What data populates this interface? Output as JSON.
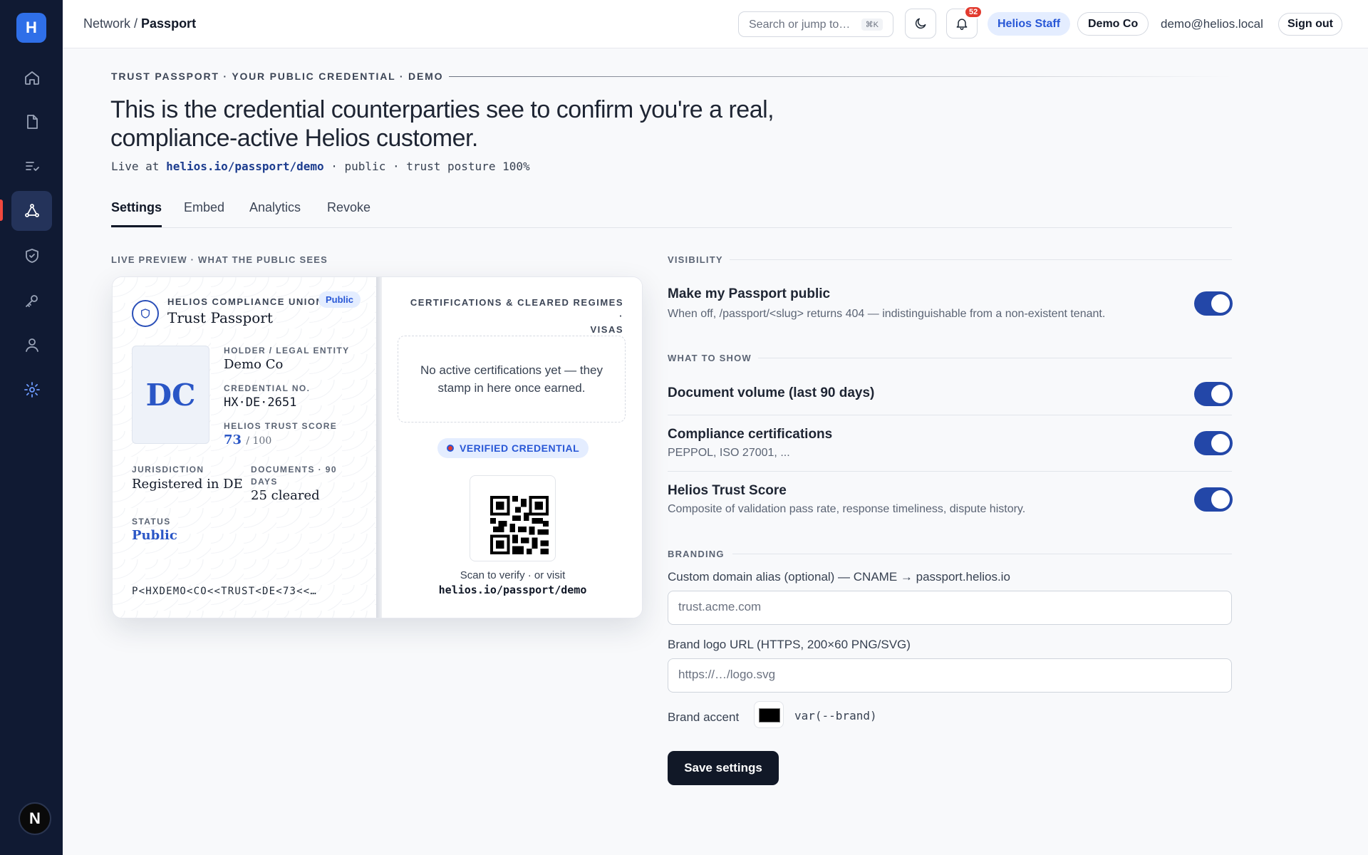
{
  "sidebar": {
    "logo": "H",
    "items": [
      {
        "icon": "home-icon"
      },
      {
        "icon": "document-icon"
      },
      {
        "icon": "checklist-icon"
      },
      {
        "icon": "network-icon"
      },
      {
        "icon": "shield-check-icon"
      },
      {
        "icon": "key-icon"
      },
      {
        "icon": "user-icon"
      },
      {
        "icon": "gear-icon"
      }
    ],
    "user_avatar": "N"
  },
  "topbar": {
    "breadcrumb_parent": "Network",
    "breadcrumb_sep": " / ",
    "breadcrumb_current": "Passport",
    "search_placeholder": "Search or jump to…",
    "search_shortcut": "⌘K",
    "notification_count": "52",
    "staff_badge": "Helios Staff",
    "org_name": "Demo Co",
    "email": "demo@helios.local",
    "signout": "Sign out"
  },
  "header": {
    "eyebrow": "TRUST PASSPORT · YOUR PUBLIC CREDENTIAL · DEMO",
    "headline": "This is the credential counterparties see to confirm you're a real, compliance-active Helios customer.",
    "live_prefix": "Live at ",
    "live_url": "helios.io/passport/demo",
    "live_suffix": " · public · trust posture 100%"
  },
  "tabs": [
    "Settings",
    "Embed",
    "Analytics",
    "Revoke"
  ],
  "preview": {
    "label": "LIVE PREVIEW · WHAT THE PUBLIC SEES",
    "issuer": "HELIOS COMPLIANCE UNION",
    "public_chip": "Public",
    "title": "Trust Passport",
    "initials": "DC",
    "holder_label": "HOLDER / LEGAL ENTITY",
    "holder_value": "Demo Co",
    "credential_label": "CREDENTIAL NO.",
    "credential_value": "HX·DE·2651",
    "score_label": "HELIOS TRUST SCORE",
    "score_value": "73",
    "score_max": "/ 100",
    "jurisdiction_label": "JURISDICTION",
    "jurisdiction_value": "Registered in DE",
    "documents_label_1": "DOCUMENTS · 90",
    "documents_label_2": "DAYS",
    "documents_value": "25 cleared",
    "status_label": "STATUS",
    "status_value": "Public",
    "mrz": "P<HXDEMO<CO<<TRUST<DE<73<<…",
    "certs_title_1": "CERTIFICATIONS & CLEARED REGIMES ·",
    "certs_title_2": "VISAS",
    "certs_empty": "No active certifications yet — they stamp in here once earned.",
    "verified": "VERIFIED CREDENTIAL",
    "scan_text": "Scan to verify · or visit",
    "scan_url": "helios.io/passport/demo"
  },
  "settings": {
    "visibility_label": "VISIBILITY",
    "public_title": "Make my Passport public",
    "public_desc": "When off, /passport/<slug> returns 404 — indistinguishable from a non-existent tenant.",
    "public_on": true,
    "show_label": "WHAT TO SHOW",
    "doc_volume_title": "Document volume (last 90 days)",
    "doc_volume_on": true,
    "certs_title": "Compliance certifications",
    "certs_desc": "PEPPOL, ISO 27001, ...",
    "certs_on": true,
    "score_title": "Helios Trust Score",
    "score_desc": "Composite of validation pass rate, response timeliness, dispute history.",
    "score_on": true,
    "branding_label": "BRANDING",
    "domain_label": "Custom domain alias (optional) — CNAME → passport.helios.io",
    "domain_placeholder": "trust.acme.com",
    "logo_label": "Brand logo URL (HTTPS, 200×60 PNG/SVG)",
    "logo_placeholder": "https://…/logo.svg",
    "accent_label": "Brand accent",
    "accent_color": "#000000",
    "accent_var": "var(--brand)",
    "save": "Save settings"
  },
  "colors": {
    "sidebar_bg": "#101a33",
    "brand_blue": "#2f6fe8",
    "toggle_on": "#2347a8",
    "badge_red": "#e23a2e"
  }
}
